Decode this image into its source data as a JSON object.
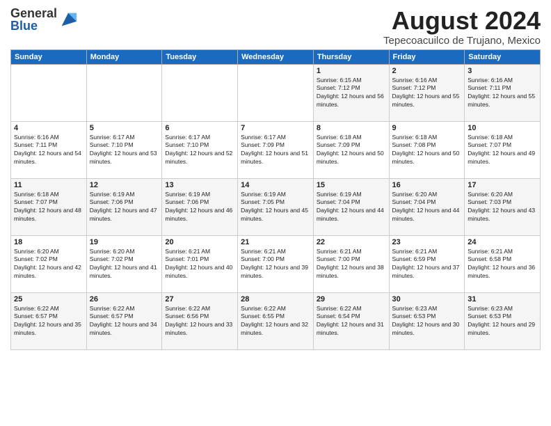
{
  "logo": {
    "general": "General",
    "blue": "Blue"
  },
  "title": "August 2024",
  "location": "Tepecoacuilco de Trujano, Mexico",
  "headers": [
    "Sunday",
    "Monday",
    "Tuesday",
    "Wednesday",
    "Thursday",
    "Friday",
    "Saturday"
  ],
  "weeks": [
    [
      {
        "day": "",
        "sunrise": "",
        "sunset": "",
        "daylight": ""
      },
      {
        "day": "",
        "sunrise": "",
        "sunset": "",
        "daylight": ""
      },
      {
        "day": "",
        "sunrise": "",
        "sunset": "",
        "daylight": ""
      },
      {
        "day": "",
        "sunrise": "",
        "sunset": "",
        "daylight": ""
      },
      {
        "day": "1",
        "sunrise": "Sunrise: 6:15 AM",
        "sunset": "Sunset: 7:12 PM",
        "daylight": "Daylight: 12 hours and 56 minutes."
      },
      {
        "day": "2",
        "sunrise": "Sunrise: 6:16 AM",
        "sunset": "Sunset: 7:12 PM",
        "daylight": "Daylight: 12 hours and 55 minutes."
      },
      {
        "day": "3",
        "sunrise": "Sunrise: 6:16 AM",
        "sunset": "Sunset: 7:11 PM",
        "daylight": "Daylight: 12 hours and 55 minutes."
      }
    ],
    [
      {
        "day": "4",
        "sunrise": "Sunrise: 6:16 AM",
        "sunset": "Sunset: 7:11 PM",
        "daylight": "Daylight: 12 hours and 54 minutes."
      },
      {
        "day": "5",
        "sunrise": "Sunrise: 6:17 AM",
        "sunset": "Sunset: 7:10 PM",
        "daylight": "Daylight: 12 hours and 53 minutes."
      },
      {
        "day": "6",
        "sunrise": "Sunrise: 6:17 AM",
        "sunset": "Sunset: 7:10 PM",
        "daylight": "Daylight: 12 hours and 52 minutes."
      },
      {
        "day": "7",
        "sunrise": "Sunrise: 6:17 AM",
        "sunset": "Sunset: 7:09 PM",
        "daylight": "Daylight: 12 hours and 51 minutes."
      },
      {
        "day": "8",
        "sunrise": "Sunrise: 6:18 AM",
        "sunset": "Sunset: 7:09 PM",
        "daylight": "Daylight: 12 hours and 50 minutes."
      },
      {
        "day": "9",
        "sunrise": "Sunrise: 6:18 AM",
        "sunset": "Sunset: 7:08 PM",
        "daylight": "Daylight: 12 hours and 50 minutes."
      },
      {
        "day": "10",
        "sunrise": "Sunrise: 6:18 AM",
        "sunset": "Sunset: 7:07 PM",
        "daylight": "Daylight: 12 hours and 49 minutes."
      }
    ],
    [
      {
        "day": "11",
        "sunrise": "Sunrise: 6:18 AM",
        "sunset": "Sunset: 7:07 PM",
        "daylight": "Daylight: 12 hours and 48 minutes."
      },
      {
        "day": "12",
        "sunrise": "Sunrise: 6:19 AM",
        "sunset": "Sunset: 7:06 PM",
        "daylight": "Daylight: 12 hours and 47 minutes."
      },
      {
        "day": "13",
        "sunrise": "Sunrise: 6:19 AM",
        "sunset": "Sunset: 7:06 PM",
        "daylight": "Daylight: 12 hours and 46 minutes."
      },
      {
        "day": "14",
        "sunrise": "Sunrise: 6:19 AM",
        "sunset": "Sunset: 7:05 PM",
        "daylight": "Daylight: 12 hours and 45 minutes."
      },
      {
        "day": "15",
        "sunrise": "Sunrise: 6:19 AM",
        "sunset": "Sunset: 7:04 PM",
        "daylight": "Daylight: 12 hours and 44 minutes."
      },
      {
        "day": "16",
        "sunrise": "Sunrise: 6:20 AM",
        "sunset": "Sunset: 7:04 PM",
        "daylight": "Daylight: 12 hours and 44 minutes."
      },
      {
        "day": "17",
        "sunrise": "Sunrise: 6:20 AM",
        "sunset": "Sunset: 7:03 PM",
        "daylight": "Daylight: 12 hours and 43 minutes."
      }
    ],
    [
      {
        "day": "18",
        "sunrise": "Sunrise: 6:20 AM",
        "sunset": "Sunset: 7:02 PM",
        "daylight": "Daylight: 12 hours and 42 minutes."
      },
      {
        "day": "19",
        "sunrise": "Sunrise: 6:20 AM",
        "sunset": "Sunset: 7:02 PM",
        "daylight": "Daylight: 12 hours and 41 minutes."
      },
      {
        "day": "20",
        "sunrise": "Sunrise: 6:21 AM",
        "sunset": "Sunset: 7:01 PM",
        "daylight": "Daylight: 12 hours and 40 minutes."
      },
      {
        "day": "21",
        "sunrise": "Sunrise: 6:21 AM",
        "sunset": "Sunset: 7:00 PM",
        "daylight": "Daylight: 12 hours and 39 minutes."
      },
      {
        "day": "22",
        "sunrise": "Sunrise: 6:21 AM",
        "sunset": "Sunset: 7:00 PM",
        "daylight": "Daylight: 12 hours and 38 minutes."
      },
      {
        "day": "23",
        "sunrise": "Sunrise: 6:21 AM",
        "sunset": "Sunset: 6:59 PM",
        "daylight": "Daylight: 12 hours and 37 minutes."
      },
      {
        "day": "24",
        "sunrise": "Sunrise: 6:21 AM",
        "sunset": "Sunset: 6:58 PM",
        "daylight": "Daylight: 12 hours and 36 minutes."
      }
    ],
    [
      {
        "day": "25",
        "sunrise": "Sunrise: 6:22 AM",
        "sunset": "Sunset: 6:57 PM",
        "daylight": "Daylight: 12 hours and 35 minutes."
      },
      {
        "day": "26",
        "sunrise": "Sunrise: 6:22 AM",
        "sunset": "Sunset: 6:57 PM",
        "daylight": "Daylight: 12 hours and 34 minutes."
      },
      {
        "day": "27",
        "sunrise": "Sunrise: 6:22 AM",
        "sunset": "Sunset: 6:56 PM",
        "daylight": "Daylight: 12 hours and 33 minutes."
      },
      {
        "day": "28",
        "sunrise": "Sunrise: 6:22 AM",
        "sunset": "Sunset: 6:55 PM",
        "daylight": "Daylight: 12 hours and 32 minutes."
      },
      {
        "day": "29",
        "sunrise": "Sunrise: 6:22 AM",
        "sunset": "Sunset: 6:54 PM",
        "daylight": "Daylight: 12 hours and 31 minutes."
      },
      {
        "day": "30",
        "sunrise": "Sunrise: 6:23 AM",
        "sunset": "Sunset: 6:53 PM",
        "daylight": "Daylight: 12 hours and 30 minutes."
      },
      {
        "day": "31",
        "sunrise": "Sunrise: 6:23 AM",
        "sunset": "Sunset: 6:53 PM",
        "daylight": "Daylight: 12 hours and 29 minutes."
      }
    ]
  ]
}
